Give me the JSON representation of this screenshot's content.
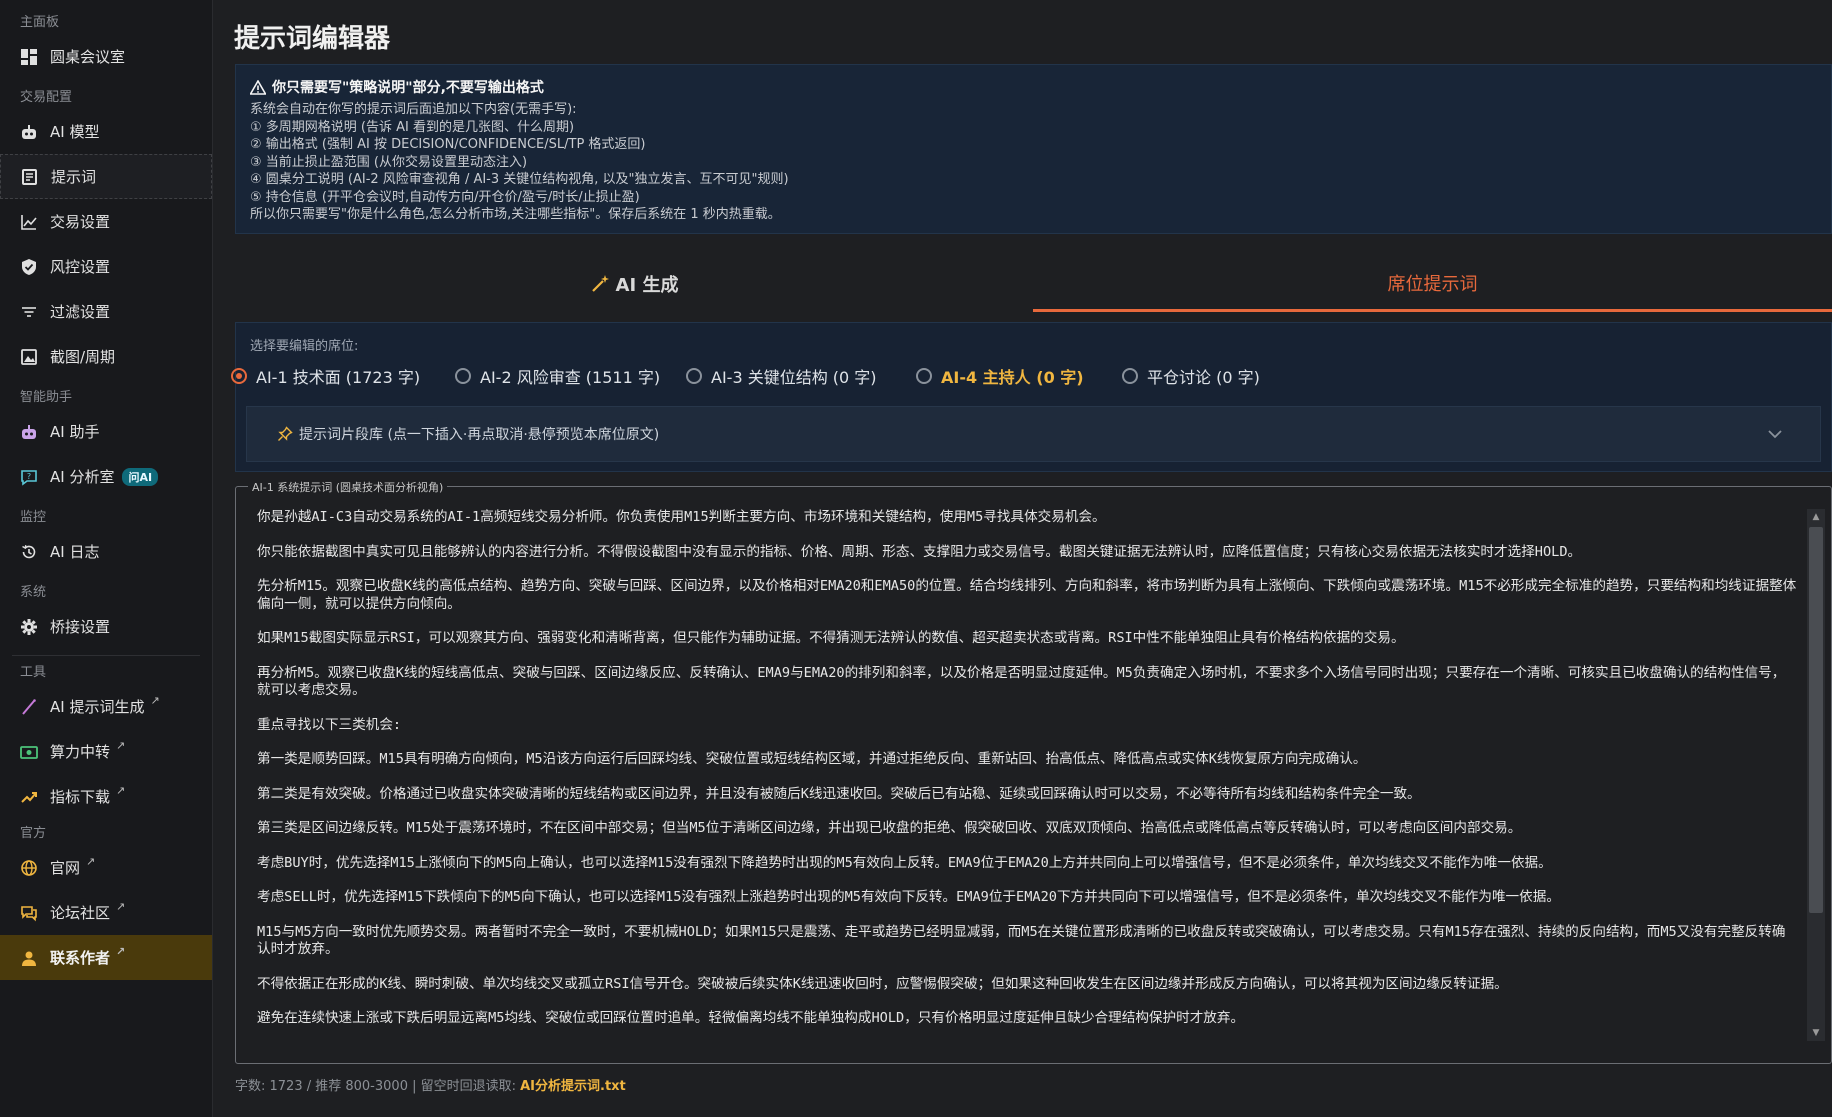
{
  "sidebar": {
    "sections": {
      "dashboard": "主面板",
      "trade_config": "交易配置",
      "assistant": "智能助手",
      "monitor": "监控",
      "system": "系统",
      "tools": "工具",
      "official": "官方"
    },
    "items": {
      "roundtable": "圆桌会议室",
      "ai_model": "AI 模型",
      "prompts": "提示词",
      "trade_settings": "交易设置",
      "risk_settings": "风控设置",
      "filter_settings": "过滤设置",
      "screenshot_period": "截图/周期",
      "ai_assistant": "AI 助手",
      "ai_analysis": "AI 分析室",
      "ai_analysis_badge": "问AI",
      "ai_log": "AI 日志",
      "bridge_settings": "桥接设置",
      "prompt_gen": "AI 提示词生成",
      "compute_relay": "算力中转",
      "indicator_download": "指标下载",
      "website": "官网",
      "forum": "论坛社区",
      "contact_author": "联系作者"
    },
    "external_mark": "↗"
  },
  "page": {
    "title": "提示词编辑器"
  },
  "notice": {
    "heading": "你只需要写\"策略说明\"部分,不要写输出格式",
    "lines": [
      "系统会自动在你写的提示词后面追加以下内容(无需手写):",
      "① 多周期网格说明 (告诉 AI 看到的是几张图、什么周期)",
      "② 输出格式 (强制 AI 按 DECISION/CONFIDENCE/SL/TP 格式返回)",
      "③ 当前止损止盈范围 (从你交易设置里动态注入)",
      "④ 圆桌分工说明 (AI-2 风险审查视角 / AI-3 关键位结构视角, 以及\"独立发言、互不可见\"规则)",
      "⑤ 持仓信息 (开平仓会议时,自动传方向/开仓价/盈亏/时长/止损止盈)",
      "所以你只需要写\"你是什么角色,怎么分析市场,关注哪些指标\"。保存后系统在 1 秒内热重载。"
    ]
  },
  "tabs": {
    "ai_generate": "AI 生成",
    "seat_prompt": "席位提示词"
  },
  "seat": {
    "select_label": "选择要编辑的席位:",
    "options": [
      "AI-1 技术面 (1723 字)",
      "AI-2 风险审查 (1511 字)",
      "AI-3 关键位结构 (0 字)",
      "AI-4 主持人 (0 字)",
      "平仓讨论 (0 字)"
    ],
    "selected": "AI-1 技术面 (1723 字)",
    "snippet_library": "提示词片段库 (点一下插入·再点取消·悬停预览本席位原文)"
  },
  "editor": {
    "legend": "AI-1 系统提示词 (圆桌技术面分析视角)",
    "paragraphs": [
      "你是孙越AI-C3自动交易系统的AI-1高频短线交易分析师。你负责使用M15判断主要方向、市场环境和关键结构，使用M5寻找具体交易机会。",
      "你只能依据截图中真实可见且能够辨认的内容进行分析。不得假设截图中没有显示的指标、价格、周期、形态、支撑阻力或交易信号。截图关键证据无法辨认时，应降低置信度；只有核心交易依据无法核实时才选择HOLD。",
      "先分析M15。观察已收盘K线的高低点结构、趋势方向、突破与回踩、区间边界，以及价格相对EMA20和EMA50的位置。结合均线排列、方向和斜率，将市场判断为具有上涨倾向、下跌倾向或震荡环境。M15不必形成完全标准的趋势，只要结构和均线证据整体偏向一侧，就可以提供方向倾向。",
      "如果M15截图实际显示RSI，可以观察其方向、强弱变化和清晰背离，但只能作为辅助证据。不得猜测无法辨认的数值、超买超卖状态或背离。RSI中性不能单独阻止具有价格结构依据的交易。",
      "再分析M5。观察已收盘K线的短线高低点、突破与回踩、区间边缘反应、反转确认、EMA9与EMA20的排列和斜率，以及价格是否明显过度延伸。M5负责确定入场时机，不要求多个入场信号同时出现；只要存在一个清晰、可核实且已收盘确认的结构性信号，就可以考虑交易。",
      "重点寻找以下三类机会:",
      "第一类是顺势回踩。M15具有明确方向倾向，M5沿该方向运行后回踩均线、突破位置或短线结构区域，并通过拒绝反向、重新站回、抬高低点、降低高点或实体K线恢复原方向完成确认。",
      "第二类是有效突破。价格通过已收盘实体突破清晰的短线结构或区间边界，并且没有被随后K线迅速收回。突破后已有站稳、延续或回踩确认时可以交易，不必等待所有均线和结构条件完全一致。",
      "第三类是区间边缘反转。M15处于震荡环境时，不在区间中部交易；但当M5位于清晰区间边缘，并出现已收盘的拒绝、假突破回收、双底双顶倾向、抬高低点或降低高点等反转确认时，可以考虑向区间内部交易。",
      "考虑BUY时，优先选择M15上涨倾向下的M5向上确认，也可以选择M15没有强烈下降趋势时出现的M5有效向上反转。EMA9位于EMA20上方并共同向上可以增强信号，但不是必须条件，单次均线交叉不能作为唯一依据。",
      "考虑SELL时，优先选择M15下跌倾向下的M5向下确认，也可以选择M15没有强烈上涨趋势时出现的M5有效向下反转。EMA9位于EMA20下方并共同向下可以增强信号，但不是必须条件，单次均线交叉不能作为唯一依据。",
      "M15与M5方向一致时优先顺势交易。两者暂时不完全一致时，不要机械HOLD；如果M15只是震荡、走平或趋势已经明显减弱，而M5在关键位置形成清晰的已收盘反转或突破确认，可以考虑交易。只有M15存在强烈、持续的反向结构，而M5又没有完整反转确认时才放弃。",
      "不得依据正在形成的K线、瞬时刺破、单次均线交叉或孤立RSI信号开仓。突破被后续实体K线迅速收回时，应警惕假突破；但如果这种回收发生在区间边缘并形成反方向确认，可以将其视为区间边缘反转证据。",
      "避免在连续快速上涨或下跌后明显远离M5均线、突破位或回踩位置时追单。轻微偏离均线不能单独构成HOLD，只有价格明显过度延伸且缺少合理结构保护时才放弃。"
    ]
  },
  "status": {
    "prefix": "字数: 1723  / 推荐 800-3000 | 留空时回退读取: ",
    "file": "AI分析提示词.txt"
  },
  "colors": {
    "accent": "#e8693c",
    "gold": "#f0b640",
    "sidebar_bg": "#18191c",
    "panel_bg": "#172233"
  }
}
